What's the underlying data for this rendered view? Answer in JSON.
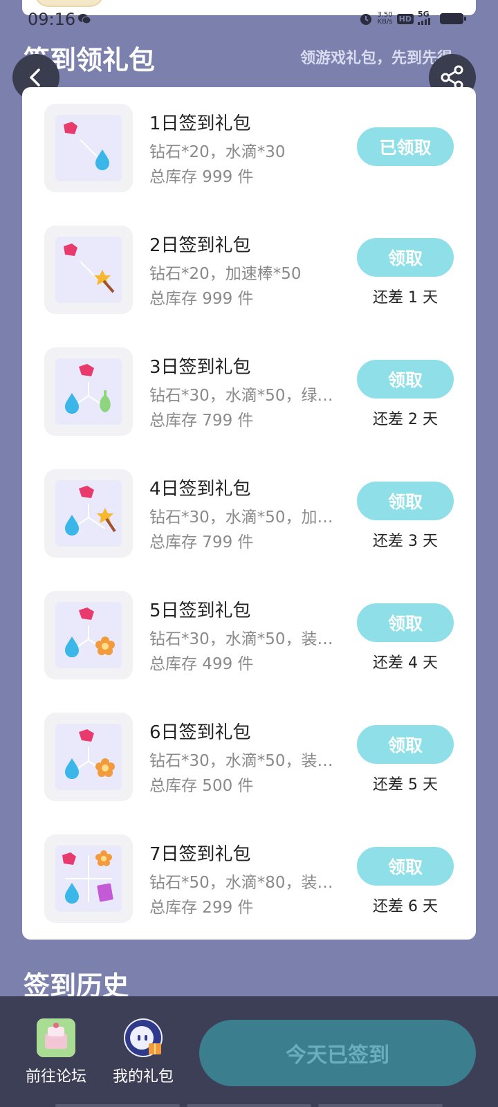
{
  "status_bar": {
    "time": "09:16",
    "net_speed_value": "3.50",
    "net_speed_unit": "KB/s",
    "hd": "HD",
    "network": "5G"
  },
  "header": {
    "title": "签到领礼包",
    "subtitle": "领游戏礼包，先到先得"
  },
  "gifts": [
    {
      "title": "1日签到礼包",
      "items": "钻石*20，水滴*30",
      "stock": "总库存 999 件",
      "button": "已领取",
      "days_left": ""
    },
    {
      "title": "2日签到礼包",
      "items": "钻石*20，加速棒*50",
      "stock": "总库存 999 件",
      "button": "领取",
      "days_left": "还差 1 天"
    },
    {
      "title": "3日签到礼包",
      "items": "钻石*30，水滴*50，绿…",
      "stock": "总库存 799 件",
      "button": "领取",
      "days_left": "还差 2 天"
    },
    {
      "title": "4日签到礼包",
      "items": "钻石*30，水滴*50，加…",
      "stock": "总库存 799 件",
      "button": "领取",
      "days_left": "还差 3 天"
    },
    {
      "title": "5日签到礼包",
      "items": "钻石*30，水滴*50，装…",
      "stock": "总库存 499 件",
      "button": "领取",
      "days_left": "还差 4 天"
    },
    {
      "title": "6日签到礼包",
      "items": "钻石*30，水滴*50，装…",
      "stock": "总库存 500 件",
      "button": "领取",
      "days_left": "还差 5 天"
    },
    {
      "title": "7日签到礼包",
      "items": "钻石*50，水滴*80，装…",
      "stock": "总库存 299 件",
      "button": "领取",
      "days_left": "还差 6 天"
    }
  ],
  "history": {
    "title": "签到历史"
  },
  "bottom_bar": {
    "forum_label": "前往论坛",
    "my_gifts_label": "我的礼包",
    "checkin_label": "今天已签到"
  },
  "colors": {
    "background": "#7c80ad",
    "button": "#8fdfe8",
    "checkin_button": "#3b7f8f",
    "bottom_bar": "#3c3f55"
  }
}
